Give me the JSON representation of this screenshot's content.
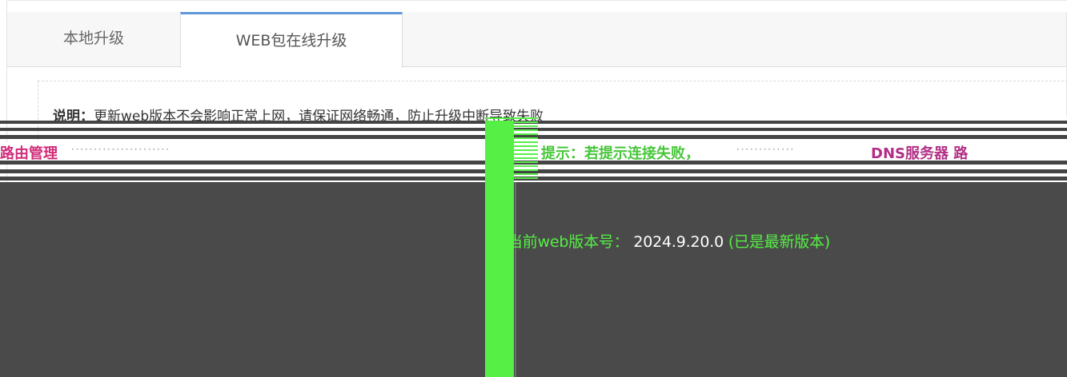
{
  "tabs": [
    {
      "label": "本地升级"
    },
    {
      "label": "WEB包在线升级"
    }
  ],
  "notice": {
    "label": "说明：",
    "text": "更新web版本不会影响正常上网，请保证网络畅通，防止升级中断导致失败"
  },
  "glitch": {
    "left_text": "路由管理",
    "hint_text": "提示：若提示连接失败，",
    "dns_text": "DNS服务器",
    "dns_suffix": "路"
  },
  "version": {
    "label": "当前web版本号：",
    "value": "2024.9.20.0",
    "status": "(已是最新版本)"
  }
}
